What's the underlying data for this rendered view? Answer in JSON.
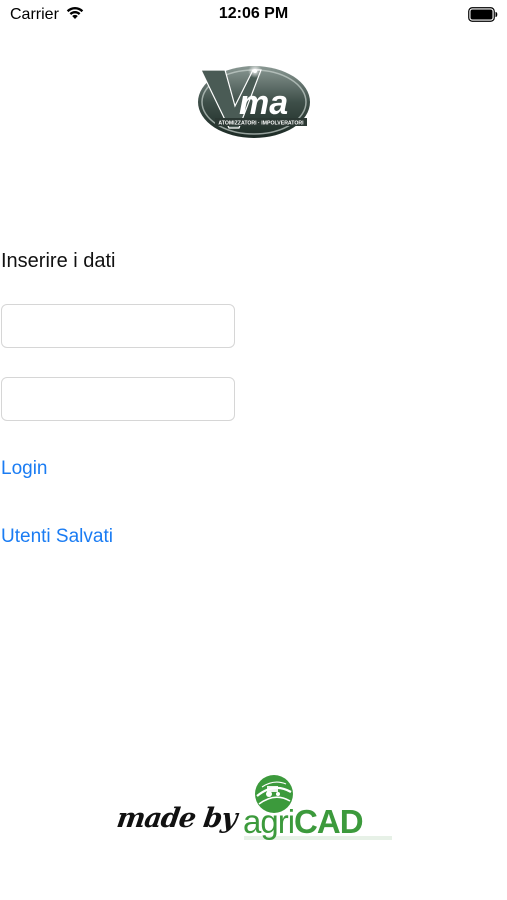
{
  "status_bar": {
    "carrier": "Carrier",
    "time": "12:06 PM",
    "wifi_icon": "wifi-icon",
    "battery_icon": "battery-full-icon"
  },
  "logo": {
    "brand": "Vma",
    "tagline": "ATOMIZZATORI · IMPOLVERATORI"
  },
  "form": {
    "title": "Inserire i dati",
    "username": {
      "value": "",
      "placeholder": ""
    },
    "password": {
      "value": "",
      "placeholder": ""
    },
    "login_label": "Login",
    "saved_users_label": "Utenti Salvati"
  },
  "footer": {
    "made_by": "made by",
    "brand_agri": "agri",
    "brand_cad": "CAD",
    "brand_icon": "tractor-globe-icon"
  },
  "colors": {
    "link": "#1a7cf3",
    "brand_green": "#3c9a3c",
    "field_border": "#d6d6d6"
  }
}
